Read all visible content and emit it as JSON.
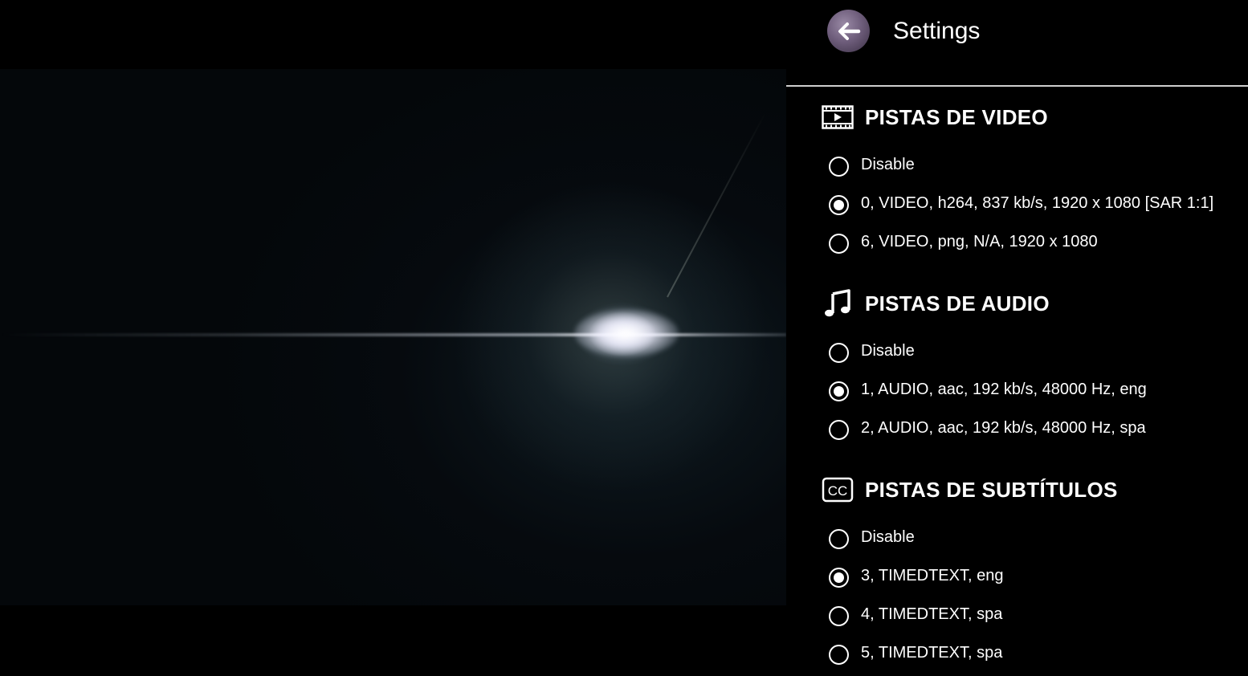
{
  "header": {
    "title": "Settings",
    "back_icon": "arrow-left-icon"
  },
  "sections": [
    {
      "title": "PISTAS DE VIDEO",
      "icon": "film-icon",
      "options": [
        {
          "label": "Disable",
          "selected": false
        },
        {
          "label": "0, VIDEO, h264, 837 kb/s, 1920 x 1080 [SAR 1:1]",
          "selected": true
        },
        {
          "label": "6, VIDEO, png, N/A, 1920 x 1080",
          "selected": false
        }
      ]
    },
    {
      "title": "PISTAS DE AUDIO",
      "icon": "music-note-icon",
      "options": [
        {
          "label": "Disable",
          "selected": false
        },
        {
          "label": "1, AUDIO, aac, 192 kb/s, 48000 Hz, eng",
          "selected": true
        },
        {
          "label": "2, AUDIO, aac, 192 kb/s, 48000 Hz, spa",
          "selected": false
        }
      ]
    },
    {
      "title": "PISTAS DE SUBTÍTULOS",
      "icon": "closed-caption-icon",
      "options": [
        {
          "label": "Disable",
          "selected": false
        },
        {
          "label": "3, TIMEDTEXT, eng",
          "selected": true
        },
        {
          "label": "4, TIMEDTEXT, spa",
          "selected": false
        },
        {
          "label": "5, TIMEDTEXT, spa",
          "selected": false
        }
      ]
    }
  ]
}
